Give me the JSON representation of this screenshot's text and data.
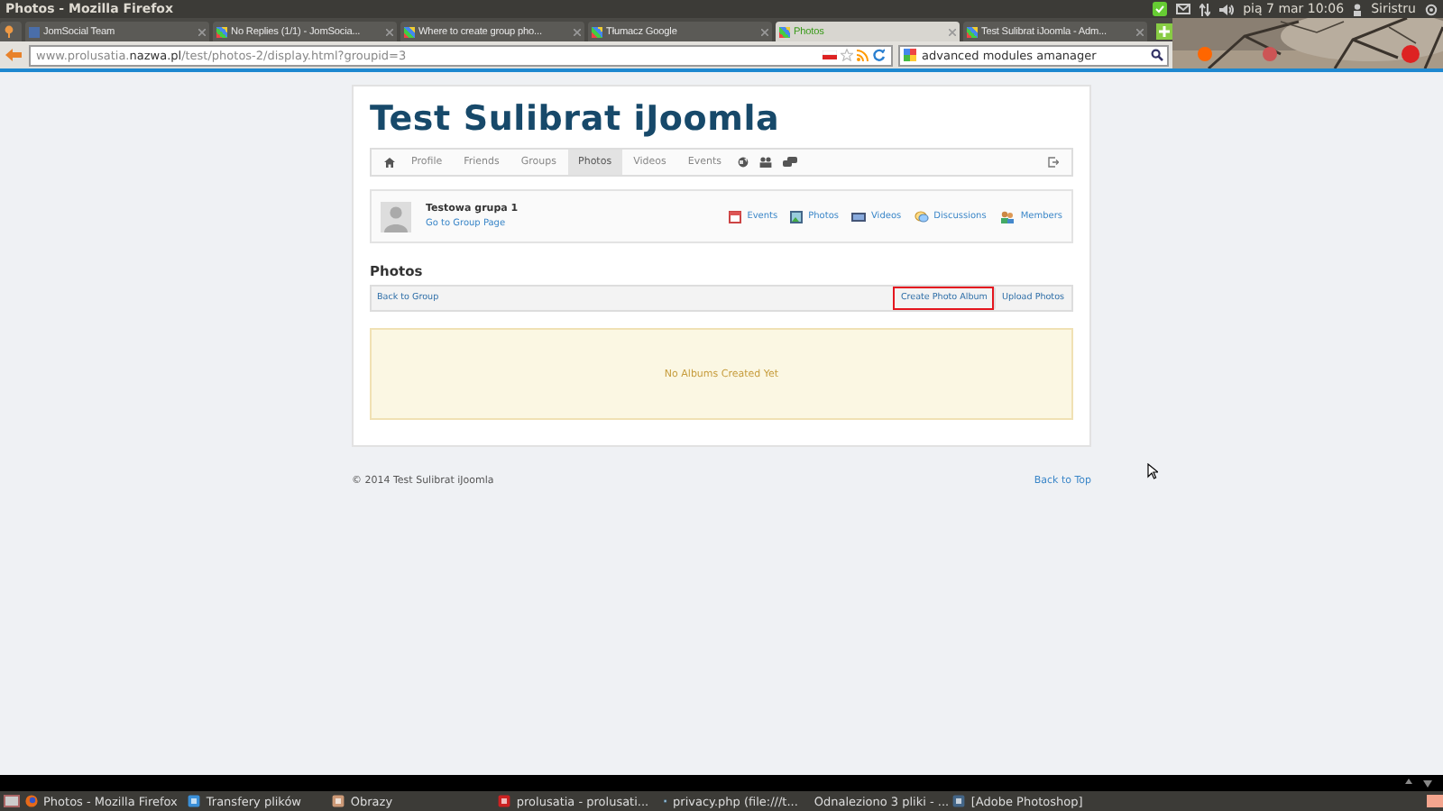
{
  "window": {
    "title": "Photos - Mozilla Firefox"
  },
  "system_tray": {
    "clock": "pią 7 mar 10:06",
    "user": "Siristru"
  },
  "tabs": [
    {
      "kind": "pinned",
      "selected": false
    },
    {
      "kind": "page",
      "label": "JomSocial Team",
      "selected": false
    },
    {
      "kind": "page",
      "label": "No Replies (1/1) - JomSocia...",
      "selected": false
    },
    {
      "kind": "page",
      "label": "Where to create group pho...",
      "selected": false
    },
    {
      "kind": "page",
      "label": "Tłumacz Google",
      "selected": false
    },
    {
      "kind": "page",
      "label": "Photos",
      "selected": true
    },
    {
      "kind": "page",
      "label": "Test Sulibrat iJoomla - Adm...",
      "selected": false
    }
  ],
  "address_bar": {
    "url": "www.prolusatia.**nazwa.pl**/test/photos-2/display.html?groupid=3"
  },
  "search": {
    "value": "advanced modules amanager"
  },
  "page": {
    "site_title": "Test Sulibrat iJoomla",
    "nav": [
      {
        "label": "Profile",
        "selected": false
      },
      {
        "label": "Friends",
        "selected": false
      },
      {
        "label": "Groups",
        "selected": false
      },
      {
        "label": "Photos",
        "selected": true
      },
      {
        "label": "Videos",
        "selected": false
      },
      {
        "label": "Events",
        "selected": false
      }
    ],
    "group": {
      "name": "Testowa grupa 1",
      "link": "Go to Group Page",
      "actions": [
        {
          "kind": "events",
          "label": "Events"
        },
        {
          "kind": "photos",
          "label": "Photos"
        },
        {
          "kind": "videos",
          "label": "Videos"
        },
        {
          "kind": "discussions",
          "label": "Discussions"
        },
        {
          "kind": "members",
          "label": "Members"
        }
      ]
    },
    "section_title": "Photos",
    "toolbar": {
      "back_link": "Back to Group",
      "buttons": [
        {
          "label": "Create Photo Album",
          "highlighted": true
        },
        {
          "label": "Upload Photos",
          "highlighted": false
        }
      ]
    },
    "empty_message": "No Albums Created Yet",
    "footer": {
      "copyright": "© 2014 Test Sulibrat iJoomla",
      "back_to_top": "Back to Top"
    }
  },
  "taskbar": [
    {
      "kind": "firefox",
      "label": "Photos - Mozilla Firefox"
    },
    {
      "kind": "transfer",
      "label": "Transfery plików"
    },
    {
      "kind": "images",
      "label": "Obrazy"
    },
    {
      "kind": "document",
      "label": "prolusatia - prolusati..."
    },
    {
      "kind": "editor",
      "label": "privacy.php (file:///t..."
    },
    {
      "kind": "folder",
      "label": "Odnaleziono 3 pliki - ..."
    },
    {
      "kind": "photoshop",
      "label": "[Adobe Photoshop]"
    }
  ]
}
